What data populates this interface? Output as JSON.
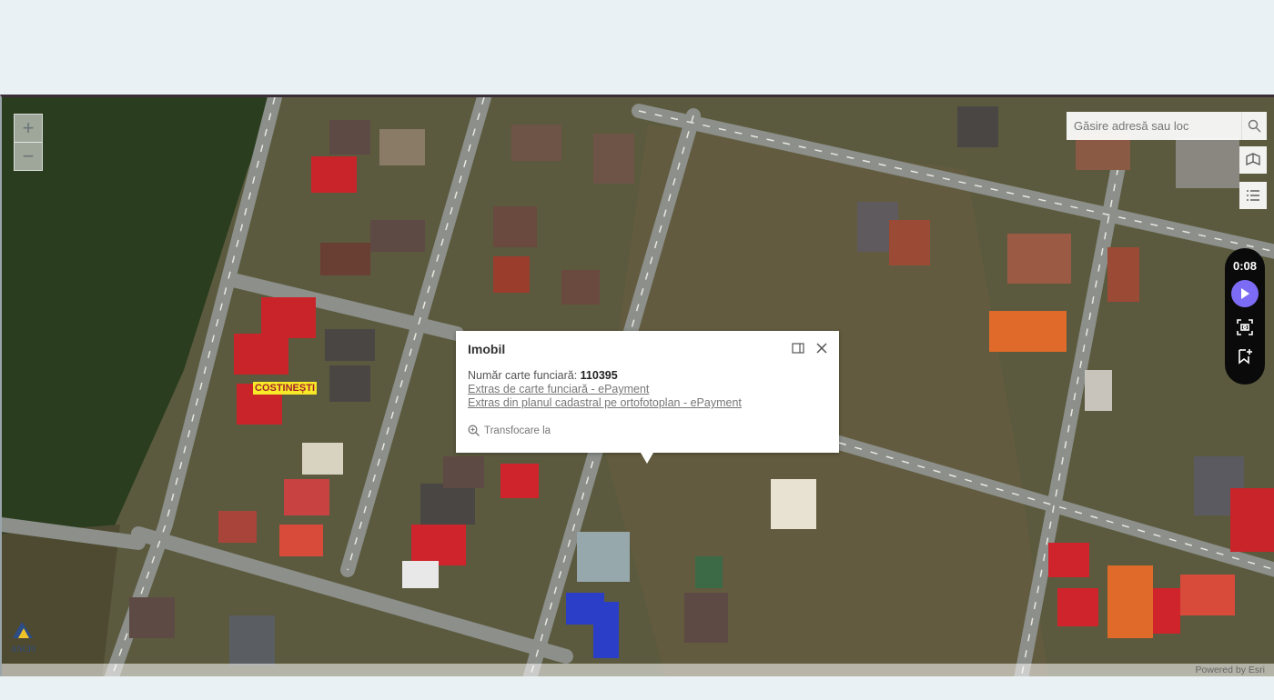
{
  "map": {
    "zoom_in": "+",
    "zoom_out": "−",
    "place_label": "COSTINEȘTI",
    "attribution": "Powered by Esri",
    "logo_text": "ANCPI"
  },
  "search": {
    "placeholder": "Găsire adresă sau loc"
  },
  "player": {
    "time": "0:08"
  },
  "popup": {
    "title": "Imobil",
    "cf_label": "Număr carte funciară: ",
    "cf_value": "110395",
    "link1": "Extras de carte funciară - ePayment",
    "link2": "Extras din planul cadastral pe ortofotoplan - ePayment",
    "zoom_label": "Transfocare la"
  },
  "colors": {
    "accent": "#7c6cf5",
    "label_bg": "#f7e928",
    "label_text": "#a2222a"
  },
  "icons": [
    "search-icon",
    "basemap-icon",
    "list-icon",
    "play-icon",
    "screenshot-icon",
    "bookmark-add-icon",
    "dock-icon",
    "close-icon",
    "zoom-to-icon"
  ]
}
